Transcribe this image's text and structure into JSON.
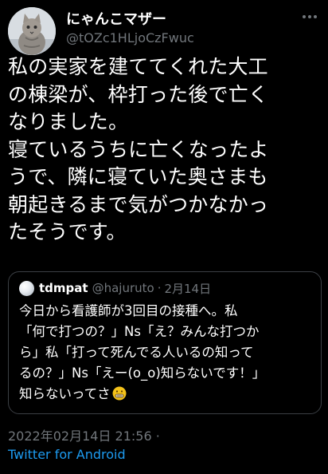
{
  "author": {
    "display_name": "にゃんこマザー",
    "handle": "@tOZc1HLjoCzFwuc"
  },
  "tweet": {
    "text": "私の実家を建ててくれた大工\nの棟梁が、枠打った後で亡く\nなりました。\n寝ているうちに亡くなったよ\nうで、隣に寝ていた奥さまも\n朝起きるまで気がつかなかっ\nたそうです。"
  },
  "quote": {
    "name": "tdmpat",
    "handle": "@hajuruto",
    "separator": "·",
    "date": "2月14日",
    "text": "今日から看護師が3回目の接種へ。私\n「何で打つの？」Ns「え？みんな打つか\nら」私「打って死んでる人いるの知って\nるの？」Ns「えー(o_o)知らないです！」\n知らないってさ",
    "emoji": "grimacing-face"
  },
  "meta": {
    "timestamp": "2022年02月14日 21:56 ·",
    "source": "Twitter for Android"
  },
  "colors": {
    "background": "#000000",
    "text_primary": "#ffffff",
    "text_secondary": "#71767b",
    "link": "#1d9bf0",
    "border": "#3b3f44"
  }
}
